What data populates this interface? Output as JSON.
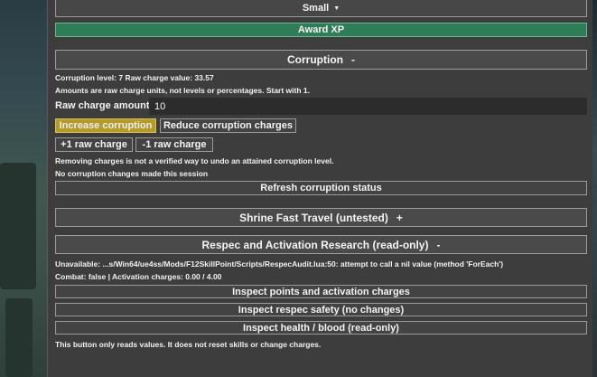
{
  "dropdown": {
    "value": "Small",
    "caret_icon": "caret-down-icon"
  },
  "award_xp": {
    "label": "Award XP"
  },
  "corruption": {
    "title": "Corruption",
    "collapse_symbol": "-",
    "status_line": "Corruption level: 7   Raw charge value: 33.57",
    "note": "Amounts are raw charge units, not levels or percentages. Start with 1.",
    "raw_amount_label": "Raw charge amount",
    "raw_amount_value": "10",
    "increase_label": "Increase corruption",
    "reduce_label": "Reduce corruption charges",
    "plus_label": "+1 raw charge",
    "minus_label": "-1 raw charge",
    "warning": "Removing charges is not a verified way to undo an attained corruption level.",
    "session_status": "No corruption changes made this session",
    "refresh_label": "Refresh corruption status"
  },
  "shrine": {
    "title": "Shrine Fast Travel (untested)",
    "expand_symbol": "+"
  },
  "respec": {
    "title": "Respec and Activation Research (read-only)",
    "collapse_symbol": "-",
    "error_line": "Unavailable: ...s/Win64/ue4ss/Mods/F12SkillPoint/Scripts/RespecAudit.lua:50: attempt to call a nil value (method 'ForEach')",
    "combat_line": "Combat: false | Activation charges: 0.00 / 4.00",
    "inspect_points_label": "Inspect points and activation charges",
    "inspect_safety_label": "Inspect respec safety (no changes)",
    "inspect_health_label": "Inspect health / blood (read-only)",
    "footer_note": "This button only reads values. It does not reset skills or change charges."
  },
  "colors": {
    "panel": "#3d3d3d",
    "green_button": "#2f7d58",
    "yellow_button": "#b59b2a"
  }
}
